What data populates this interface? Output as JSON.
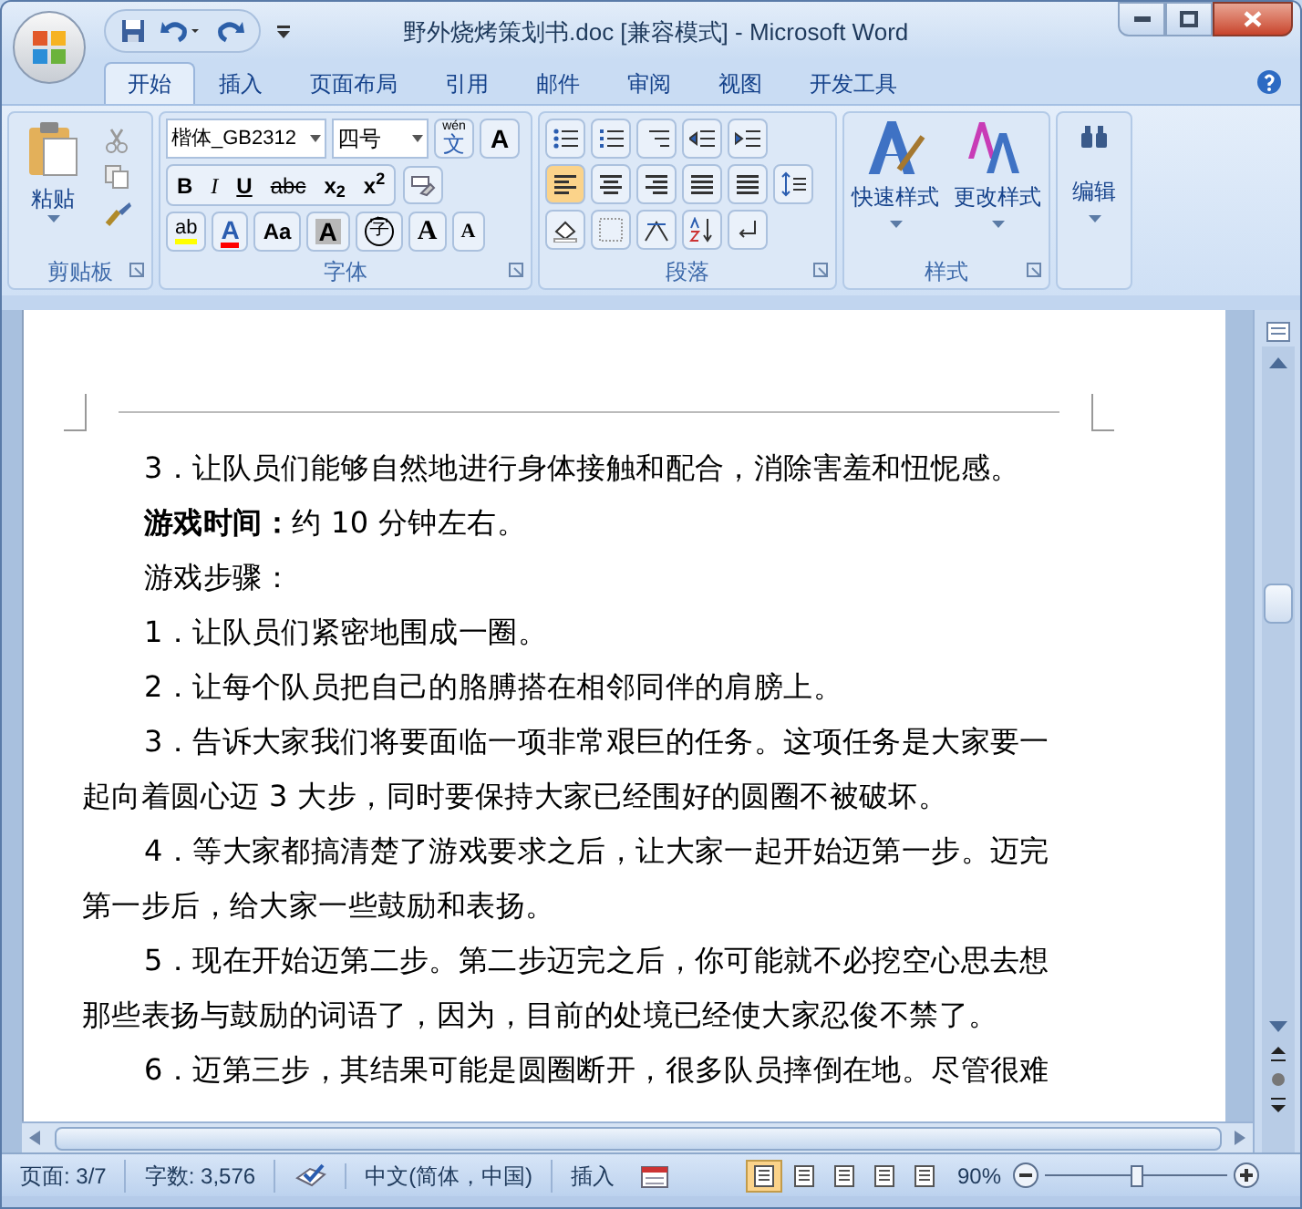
{
  "window": {
    "title": "野外烧烤策划书.doc [兼容模式] - Microsoft Word"
  },
  "tabs": [
    {
      "label": "开始",
      "selected": true
    },
    {
      "label": "插入",
      "selected": false
    },
    {
      "label": "页面布局",
      "selected": false
    },
    {
      "label": "引用",
      "selected": false
    },
    {
      "label": "邮件",
      "selected": false
    },
    {
      "label": "审阅",
      "selected": false
    },
    {
      "label": "视图",
      "selected": false
    },
    {
      "label": "开发工具",
      "selected": false
    }
  ],
  "clipboard": {
    "label": "剪贴板",
    "paste": "粘贴"
  },
  "font": {
    "label": "字体",
    "font_name": "楷体_GB2312",
    "font_size": "四号",
    "phonetic": "wén",
    "phonetic_char": "文",
    "border_char": "A",
    "format_buttons": [
      {
        "kind": "bold",
        "text": "B"
      },
      {
        "kind": "italic",
        "text": "I"
      },
      {
        "kind": "underline",
        "text": "U"
      },
      {
        "kind": "strike",
        "text": "abc"
      },
      {
        "kind": "sub",
        "text": "x$_{2}$"
      },
      {
        "kind": "sup",
        "text": "x$^{2}$"
      }
    ],
    "row3": [
      {
        "kind": "highlight",
        "text": "ab"
      },
      {
        "kind": "color",
        "text": "A"
      },
      {
        "kind": "case",
        "text": "Aa"
      },
      {
        "kind": "shade",
        "text": "A"
      },
      {
        "kind": "enclose",
        "text": "字"
      },
      {
        "kind": "grow",
        "text": "A"
      },
      {
        "kind": "shrink",
        "text": "A"
      }
    ]
  },
  "paragraph": {
    "label": "段落"
  },
  "styles": {
    "label": "样式",
    "buttons": [
      "快速样式",
      "更改样式"
    ]
  },
  "editing": {
    "label": "编辑"
  },
  "document": {
    "paragraphs": [
      "3．让队员们能够自然地进行身体接触和配合，消除害羞和忸怩感。",
      "**游戏时间：**约 10 分钟左右。",
      "游戏步骤：",
      "1．让队员们紧密地围成一圈。",
      "2．让每个队员把自己的胳膊搭在相邻同伴的肩膀上。",
      "3．告诉大家我们将要面临一项非常艰巨的任务。这项任务是大家要一起向着圆心迈 3 大步，同时要保持大家已经围好的圆圈不被破坏。",
      "4．等大家都搞清楚了游戏要求之后，让大家一起开始迈第一步。迈完第一步后，给大家一些鼓励和表扬。",
      "5．现在开始迈第二步。第二步迈完之后，你可能就不必挖空心思去想那些表扬与鼓励的词语了，因为，目前的处境已经使大家忍俊不禁了。",
      "6．迈第三步，其结果可能是圆圈断开，很多队员摔倒在地。尽管很难"
    ]
  },
  "status_bar": {
    "page": "页面: 3/7",
    "words": "字数: 3,576",
    "language": "中文(简体，中国)",
    "mode": "插入",
    "views": [
      {
        "selected": true
      },
      {
        "selected": false
      },
      {
        "selected": false
      },
      {
        "selected": false
      },
      {
        "selected": false
      }
    ],
    "zoom": "90%",
    "zoom_slider": {
      "level": 0.5
    }
  }
}
